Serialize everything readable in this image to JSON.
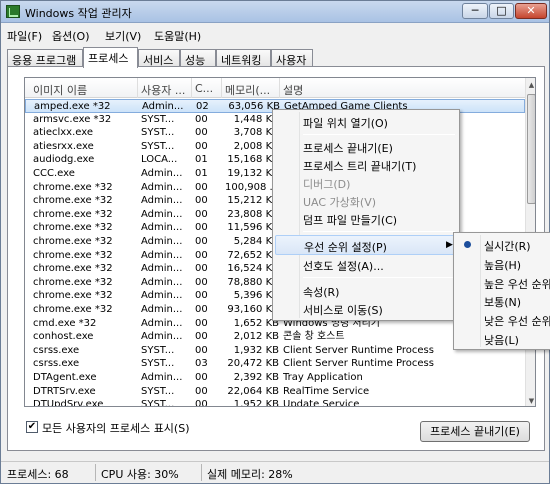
{
  "window": {
    "title": "Windows 작업 관리자",
    "min": "─",
    "max": "□",
    "close": "✕"
  },
  "menu": [
    "파일(F)",
    "옵션(O)",
    "보기(V)",
    "도움말(H)"
  ],
  "tabs": [
    "응용 프로그램",
    "프로세스",
    "서비스",
    "성능",
    "네트워킹",
    "사용자"
  ],
  "columns": [
    "이미지 이름",
    "사용자 ...",
    "C...",
    "메모리(...",
    "설명"
  ],
  "rows": [
    {
      "name": "amped.exe *32",
      "user": "Admin...",
      "cpu": "02",
      "mem": "63,056 KB",
      "desc": "GetAmped Game Clients"
    },
    {
      "name": "armsvc.exe *32",
      "user": "SYST...",
      "cpu": "00",
      "mem": "1,448 KB",
      "desc": ""
    },
    {
      "name": "atieclxx.exe",
      "user": "SYST...",
      "cpu": "00",
      "mem": "3,708 KB",
      "desc": ""
    },
    {
      "name": "atiesrxx.exe",
      "user": "SYST...",
      "cpu": "00",
      "mem": "2,008 KB",
      "desc": ""
    },
    {
      "name": "audiodg.exe",
      "user": "LOCA...",
      "cpu": "01",
      "mem": "15,168 KB",
      "desc": ""
    },
    {
      "name": "CCC.exe",
      "user": "Admin...",
      "cpu": "01",
      "mem": "19,132 KB",
      "desc": "tion"
    },
    {
      "name": "chrome.exe *32",
      "user": "Admin...",
      "cpu": "00",
      "mem": "100,908 ...",
      "desc": ""
    },
    {
      "name": "chrome.exe *32",
      "user": "Admin...",
      "cpu": "00",
      "mem": "15,212 KB",
      "desc": ""
    },
    {
      "name": "chrome.exe *32",
      "user": "Admin...",
      "cpu": "00",
      "mem": "23,808 KB",
      "desc": ""
    },
    {
      "name": "chrome.exe *32",
      "user": "Admin...",
      "cpu": "00",
      "mem": "11,596 KB",
      "desc": ""
    },
    {
      "name": "chrome.exe *32",
      "user": "Admin...",
      "cpu": "00",
      "mem": "5,284 KB",
      "desc": ""
    },
    {
      "name": "chrome.exe *32",
      "user": "Admin...",
      "cpu": "00",
      "mem": "72,652 KB",
      "desc": ""
    },
    {
      "name": "chrome.exe *32",
      "user": "Admin...",
      "cpu": "00",
      "mem": "16,524 KB",
      "desc": ""
    },
    {
      "name": "chrome.exe *32",
      "user": "Admin...",
      "cpu": "00",
      "mem": "78,880 KB",
      "desc": ""
    },
    {
      "name": "chrome.exe *32",
      "user": "Admin...",
      "cpu": "00",
      "mem": "5,396 KB",
      "desc": ""
    },
    {
      "name": "chrome.exe *32",
      "user": "Admin...",
      "cpu": "00",
      "mem": "93,160 KB",
      "desc": ""
    },
    {
      "name": "cmd.exe *32",
      "user": "Admin...",
      "cpu": "00",
      "mem": "1,652 KB",
      "desc": "Windows 명령 처리기"
    },
    {
      "name": "conhost.exe",
      "user": "Admin...",
      "cpu": "00",
      "mem": "2,012 KB",
      "desc": "콘솔 창 호스트"
    },
    {
      "name": "csrss.exe",
      "user": "SYST...",
      "cpu": "00",
      "mem": "1,932 KB",
      "desc": "Client Server Runtime Process"
    },
    {
      "name": "csrss.exe",
      "user": "SYST...",
      "cpu": "03",
      "mem": "20,472 KB",
      "desc": "Client Server Runtime Process"
    },
    {
      "name": "DTAgent.exe",
      "user": "Admin...",
      "cpu": "00",
      "mem": "2,392 KB",
      "desc": "Tray Application"
    },
    {
      "name": "DTRTSrv.exe",
      "user": "SYST...",
      "cpu": "00",
      "mem": "22,064 KB",
      "desc": "RealTime Service"
    },
    {
      "name": "DTUpdSrv.exe",
      "user": "SYST...",
      "cpu": "00",
      "mem": "1,952 KB",
      "desc": "Update Service"
    }
  ],
  "context_menu": [
    "파일 위치 열기(O)",
    "프로세스 끝내기(E)",
    "프로세스 트리 끝내기(T)",
    "디버그(D)",
    "UAC 가상화(V)",
    "덤프 파일 만들기(C)",
    "우선 순위 설정(P)",
    "선호도 설정(A)...",
    "속성(R)",
    "서비스로 이동(S)"
  ],
  "submenu": [
    "실시간(R)",
    "높음(H)",
    "높은 우선 순위",
    "보통(N)",
    "낮은 우선 순위",
    "낮음(L)"
  ],
  "show_all_label": "모든 사용자의 프로세스 표시(S)",
  "show_all_check": "✔",
  "end_process_label": "프로세스 끝내기(E)",
  "status": [
    "프로세스: 68",
    "CPU 사용: 30%",
    "실제 메모리: 28%"
  ],
  "accent": "#1c4e9c"
}
